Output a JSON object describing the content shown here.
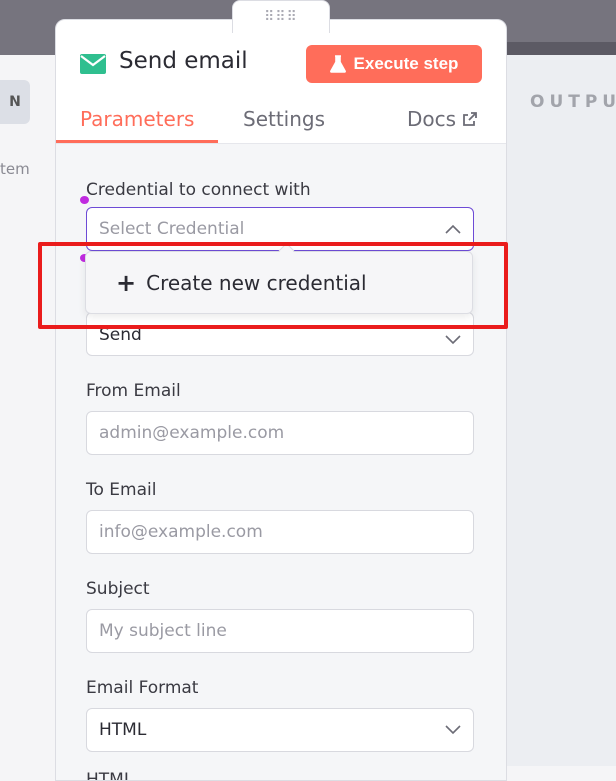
{
  "background": {
    "left_button_label": "N",
    "left_text": "tem",
    "output_label": "OUTPU"
  },
  "drag_handle": "⠿⠿⠿",
  "node": {
    "title": "Send email",
    "icon": "envelope-icon",
    "execute_label": "Execute step",
    "execute_icon": "flask-icon",
    "accent": "#ff6d5a",
    "icon_color": "#2fbf8f"
  },
  "tabs": {
    "parameters": "Parameters",
    "settings": "Settings",
    "docs": "Docs"
  },
  "form": {
    "credential": {
      "label": "Credential to connect with",
      "placeholder": "Select Credential"
    },
    "operation": {
      "value": "Send"
    },
    "from_email": {
      "label": "From Email",
      "placeholder": "admin@example.com"
    },
    "to_email": {
      "label": "To Email",
      "placeholder": "info@example.com"
    },
    "subject": {
      "label": "Subject",
      "placeholder": "My subject line"
    },
    "email_format": {
      "label": "Email Format",
      "value": "HTML"
    },
    "html": {
      "label": "HTML"
    }
  },
  "dropdown": {
    "create_label": "Create new credential"
  },
  "highlight_color": "#ea1c1c"
}
